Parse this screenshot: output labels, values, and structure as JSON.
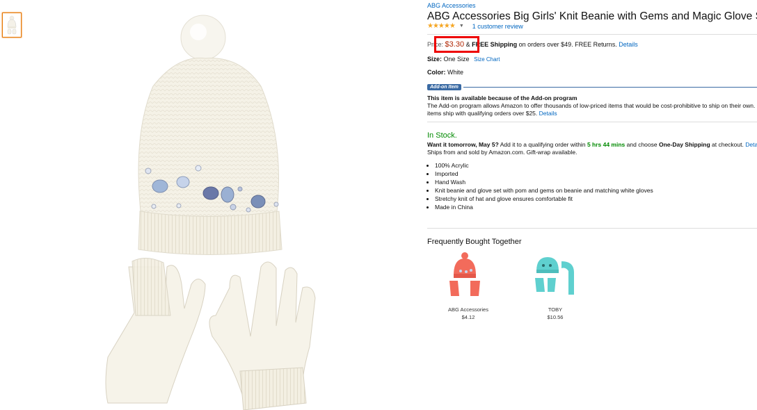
{
  "brand": "ABG Accessories",
  "title": "ABG Accessories Big Girls' Knit Beanie with Gems and Magic Glove Set",
  "reviews": {
    "stars": 5,
    "review_link": "1 customer review"
  },
  "price": {
    "label": "Price:",
    "amount": "$3.30",
    "amp": "&",
    "free_shipping": "FREE Shipping",
    "shipping_text": "on orders over $49. FREE Returns.",
    "details_link": "Details"
  },
  "size": {
    "label": "Size:",
    "value": "One Size",
    "chart_link": "Size Chart"
  },
  "color": {
    "label": "Color:",
    "value": "White"
  },
  "addon": {
    "badge": "Add-on Item",
    "heading": "This item is available because of the Add-on program",
    "line1": "The Add-on program allows Amazon to offer thousands of low-priced items that would be cost-prohibitive to ship on their own.",
    "line2": "items ship with qualifying orders over $25.",
    "details_link": "Details"
  },
  "availability": {
    "stock": "In Stock.",
    "want_prefix": "Want it tomorrow, May 5?",
    "want_middle": "Add it to a qualifying order within",
    "countdown": "5 hrs 44 mins",
    "want_and": "and choose",
    "one_day": "One-Day Shipping",
    "want_suffix": "at checkout.",
    "details_link": "Details",
    "ships_from": "Ships from and sold by Amazon.com. Gift-wrap available."
  },
  "bullets": [
    "100% Acrylic",
    "Imported",
    "Hand Wash",
    "Knit beanie and glove set with pom and gems on beanie and matching white gloves",
    "Stretchy knit of hat and glove ensures comfortable fit",
    "Made in China"
  ],
  "fbt": {
    "title": "Frequently Bought Together",
    "items": [
      {
        "brand": "ABG Accessories",
        "price": "$4.12",
        "color": "#f26b5b"
      },
      {
        "brand": "TOBY",
        "price": "$10.56",
        "color": "#5fd0cf"
      }
    ]
  },
  "colors": {
    "price": "#b12704",
    "link": "#0066c0",
    "stock": "#008a00",
    "highlight": "#e00000",
    "thumb_border": "#e77600"
  }
}
